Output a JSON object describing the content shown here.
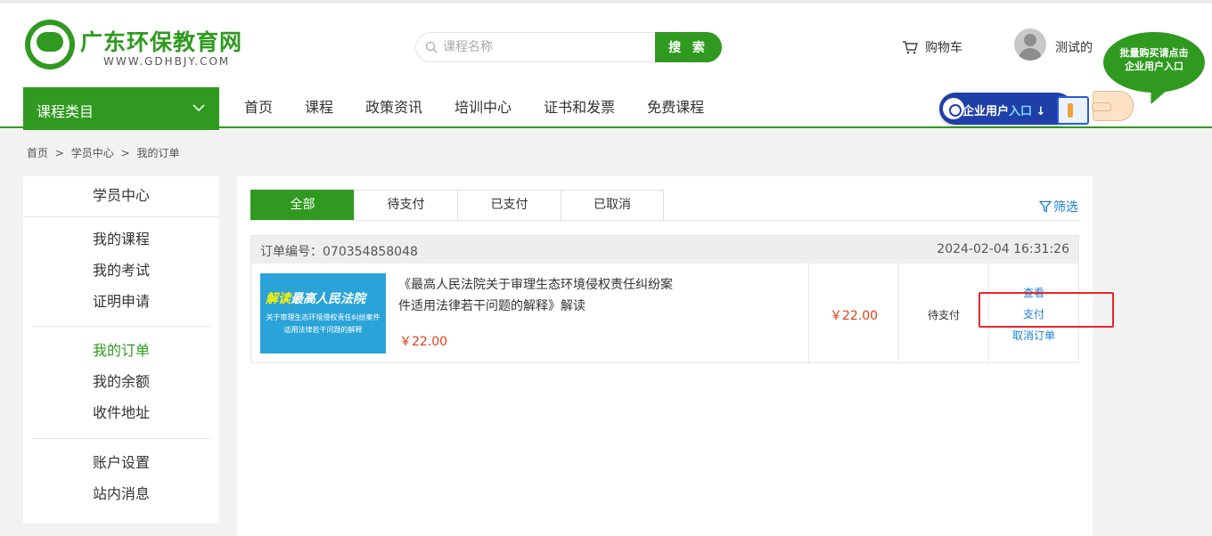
{
  "header": {
    "logo_title": "广东环保教育网",
    "logo_sub": "WWW.GDHBJY.COM",
    "search": {
      "placeholder": "课程名称",
      "button": "搜 索"
    },
    "cart_label": "购物车",
    "username": "测试的",
    "promo_bubble": [
      "批量购买请点击",
      "企业用户入口"
    ],
    "enterprise_prefix": "企业用户",
    "enterprise_highlight": "入口"
  },
  "nav": {
    "category_label": "课程类目",
    "items": [
      "首页",
      "课程",
      "政策资讯",
      "培训中心",
      "证书和发票",
      "免费课程"
    ]
  },
  "breadcrumb": [
    "首页",
    ">",
    "学员中心",
    ">",
    "我的订单"
  ],
  "sidebar": {
    "title": "学员中心",
    "group1": [
      "我的课程",
      "我的考试",
      "证明申请"
    ],
    "group2": [
      "我的订单",
      "我的余额",
      "收件地址"
    ],
    "group3": [
      "账户设置",
      "站内消息"
    ],
    "active": "我的订单"
  },
  "orders": {
    "tabs": [
      "全部",
      "待支付",
      "已支付",
      "已取消"
    ],
    "active_tab": "全部",
    "filter_label": "筛选",
    "list": [
      {
        "order_no_label": "订单编号：070354858048",
        "time": "2024-02-04 16:31:26",
        "thumb_title_yellow": "解读",
        "thumb_title_white": "最高人民法院",
        "thumb_line1": "关于审理生态环境侵权责任纠纷案件",
        "thumb_line2": "适用法律若干问题的解释",
        "course_title": "《最高人民法院关于审理生态环境侵权责任纠纷案件适用法律若干问题的解释》解读",
        "course_price": "￥22.00",
        "price": "￥22.00",
        "status": "待支付",
        "actions": [
          "查看",
          "支付",
          "取消订单"
        ]
      }
    ]
  },
  "colors": {
    "brand_green": "#2f9a1f",
    "link_blue": "#1a7fd6",
    "price_red": "#e0401a",
    "highlight_red": "#e8262a"
  }
}
